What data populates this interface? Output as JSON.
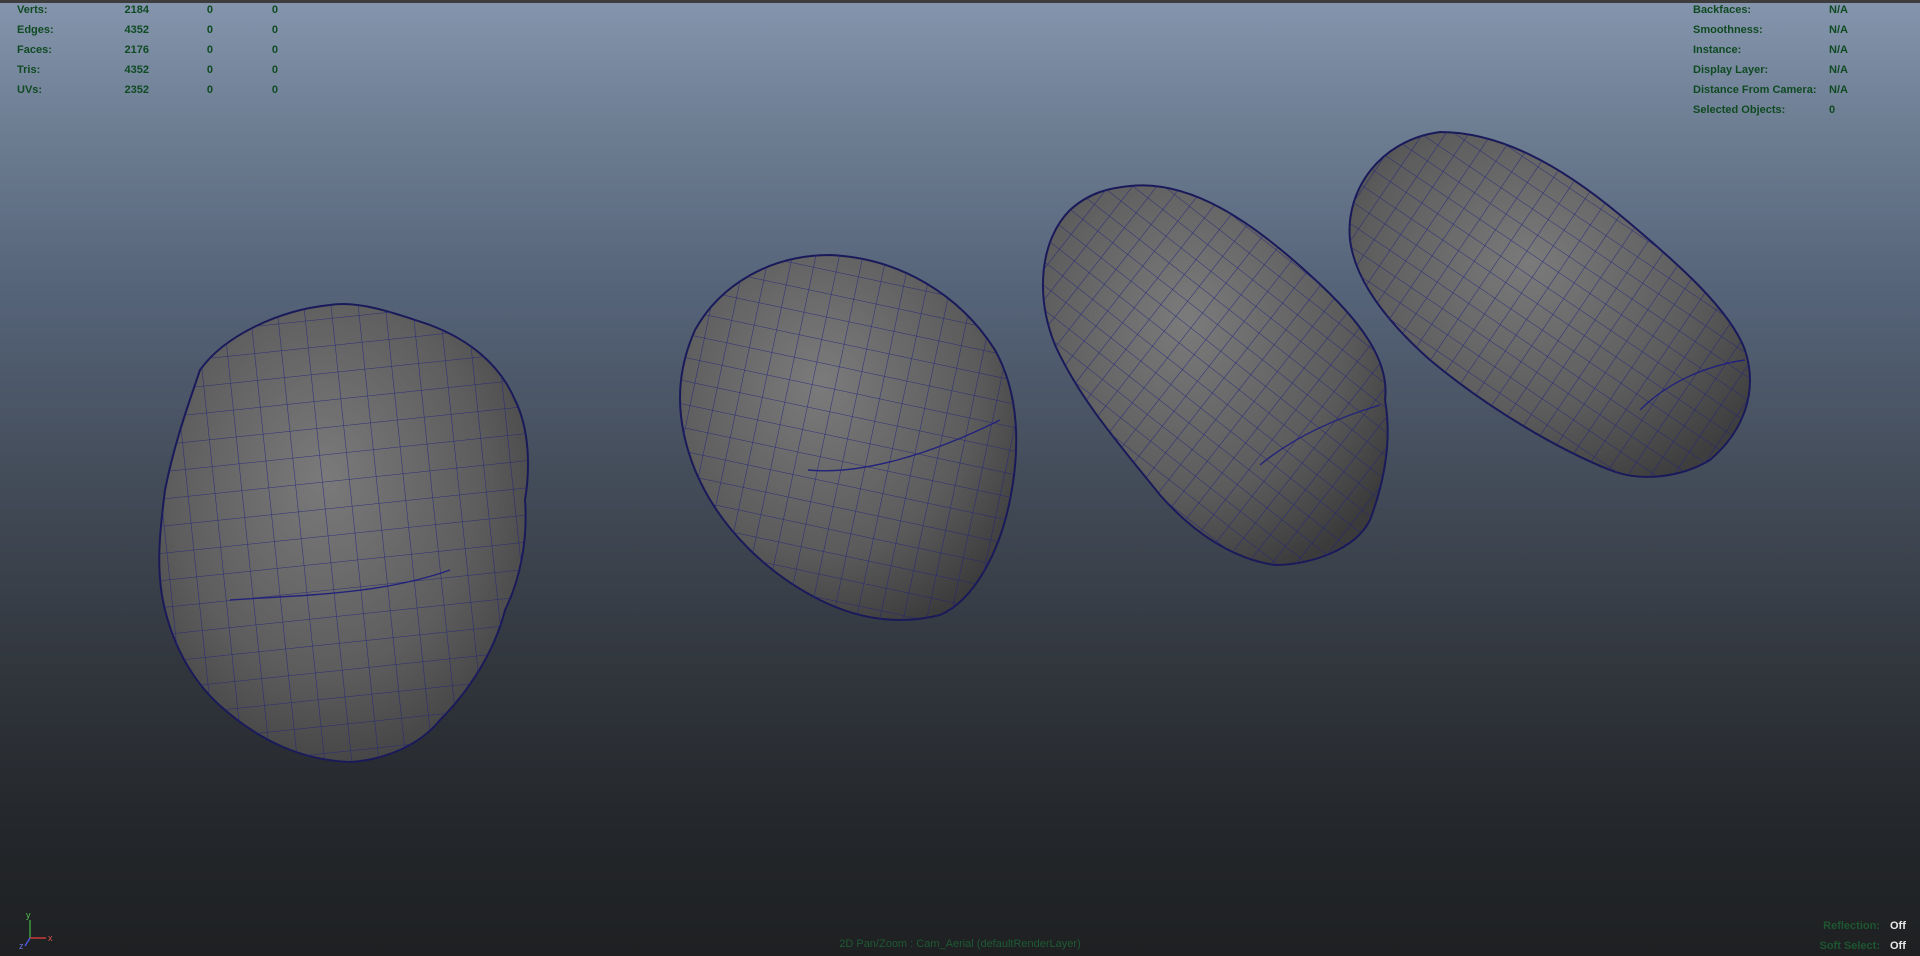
{
  "hud_left": {
    "rows": [
      {
        "label": "Verts:",
        "v1": "2184",
        "v2": "0",
        "v3": "0"
      },
      {
        "label": "Edges:",
        "v1": "4352",
        "v2": "0",
        "v3": "0"
      },
      {
        "label": "Faces:",
        "v1": "2176",
        "v2": "0",
        "v3": "0"
      },
      {
        "label": "Tris:",
        "v1": "4352",
        "v2": "0",
        "v3": "0"
      },
      {
        "label": "UVs:",
        "v1": "2352",
        "v2": "0",
        "v3": "0"
      }
    ]
  },
  "hud_right": {
    "rows": [
      {
        "label": "Backfaces:",
        "value": "N/A"
      },
      {
        "label": "Smoothness:",
        "value": "N/A"
      },
      {
        "label": "Instance:",
        "value": "N/A"
      },
      {
        "label": "Display Layer:",
        "value": "N/A"
      },
      {
        "label": "Distance From Camera:",
        "value": "N/A"
      },
      {
        "label": "Selected Objects:",
        "value": "0"
      }
    ]
  },
  "camera_label": "2D Pan/Zoom : Cam_Aerial (defaultRenderLayer)",
  "bottom_right": {
    "reflection_label": "Reflection:",
    "reflection_value": "Off",
    "soft_select_label": "Soft Select:",
    "soft_select_value": "Off"
  },
  "axis": {
    "y": "y",
    "x": "x",
    "z": "z"
  },
  "colors": {
    "hud_text": "#0f4a22",
    "wireframe": "#22227a",
    "mesh_fill": "#5c5c5c",
    "viewport_top": "#8495ad",
    "viewport_bottom": "#1e2022"
  },
  "models": [
    {
      "name": "lumpy-potato"
    },
    {
      "name": "rounded-block"
    },
    {
      "name": "capsule-medium"
    },
    {
      "name": "capsule-long"
    }
  ]
}
